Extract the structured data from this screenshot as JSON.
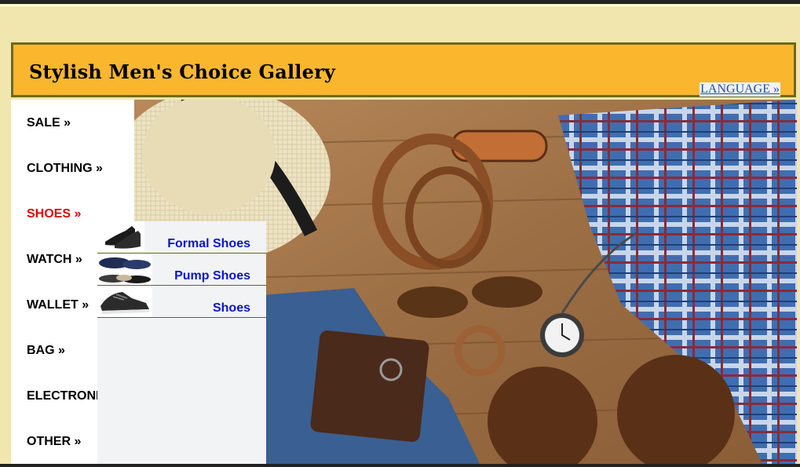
{
  "header": {
    "title": "Stylish Men's Choice Gallery",
    "language_link": "LANGUAGE »"
  },
  "sidebar": {
    "items": [
      {
        "label": "SALE »",
        "active": false
      },
      {
        "label": "CLOTHING »",
        "active": false
      },
      {
        "label": "SHOES »",
        "active": true
      },
      {
        "label": "WATCH »",
        "active": false
      },
      {
        "label": "WALLET »",
        "active": false
      },
      {
        "label": "BAG »",
        "active": false
      },
      {
        "label": "ELECTRONIC »",
        "active": false
      },
      {
        "label": "OTHER »",
        "active": false
      }
    ]
  },
  "submenu": {
    "items": [
      {
        "label": "Formal Shoes",
        "icon": "formal-shoe-thumbnail"
      },
      {
        "label": "Pump Shoes",
        "icon": "pump-shoe-thumbnail"
      },
      {
        "label": "Shoes",
        "icon": "sneaker-thumbnail"
      }
    ]
  },
  "colors": {
    "page_bg": "#f0e6ae",
    "header_bg": "#fab72d",
    "header_border": "#6d6a1a",
    "active_menu": "#e10000",
    "submenu_link": "#0a16c8"
  }
}
